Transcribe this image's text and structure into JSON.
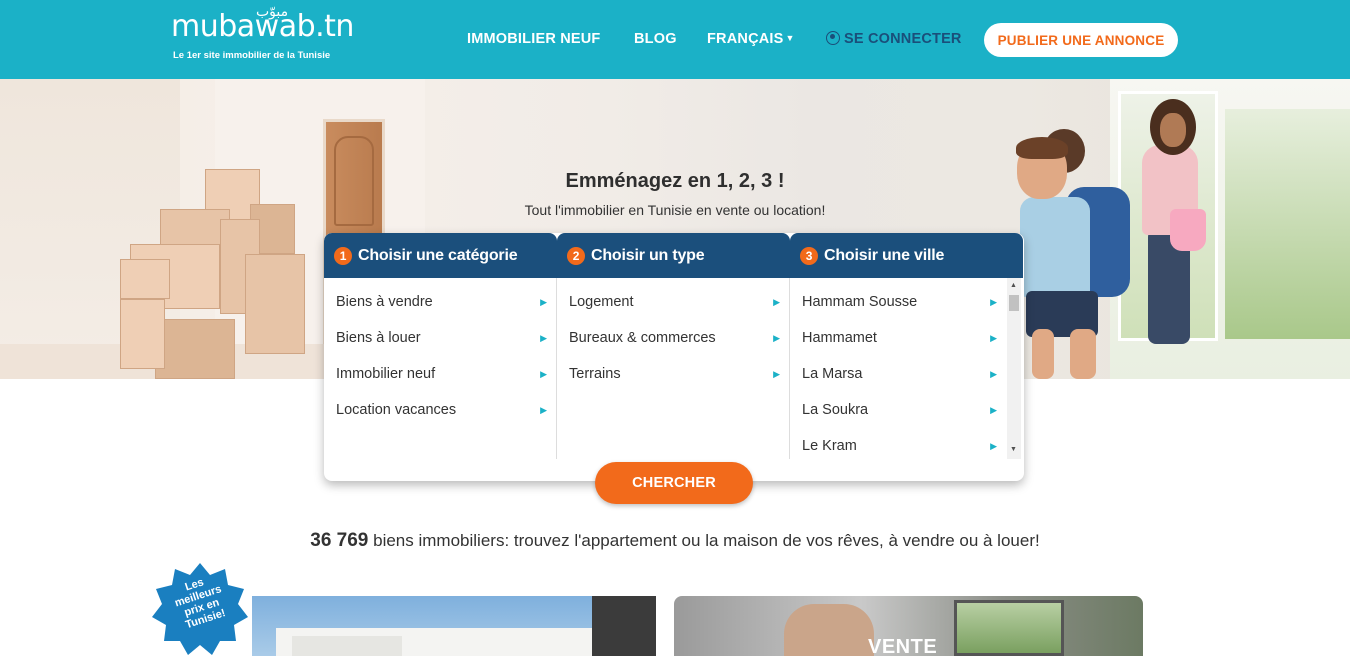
{
  "header": {
    "logo_text": "mubawab.tn",
    "logo_arabic": "مبوّب",
    "logo_tagline": "Le 1er site immobilier de la Tunisie",
    "nav": {
      "immobilier_neuf": "IMMOBILIER NEUF",
      "blog": "BLOG",
      "language": "FRANÇAIS",
      "login": "SE CONNECTER"
    },
    "publish_button": "PUBLIER UNE ANNONCE",
    "background_color": "#1bb1c7"
  },
  "hero": {
    "title": "Emménagez en 1, 2, 3 !",
    "subtitle": "Tout l'immobilier en Tunisie en vente ou location!"
  },
  "search": {
    "category": {
      "step": "1",
      "header": "Choisir une catégorie",
      "items": [
        "Biens à vendre",
        "Biens à louer",
        "Immobilier neuf",
        "Location vacances"
      ]
    },
    "type": {
      "step": "2",
      "header": "Choisir un type",
      "items": [
        "Logement",
        "Bureaux & commerces",
        "Terrains"
      ]
    },
    "city": {
      "step": "3",
      "header": "Choisir une ville",
      "items": [
        "Hammam Sousse",
        "Hammamet",
        "La Marsa",
        "La Soukra",
        "Le Kram"
      ]
    },
    "button": "CHERCHER",
    "header_color": "#1b4f7c",
    "accent_color": "#f26a1b"
  },
  "summary": {
    "count": "36 769",
    "text": "biens immobiliers: trouvez l'appartement ou la maison de vos rêves, à vendre ou à louer!"
  },
  "cards": {
    "badge_text": "Les meilleurs prix en Tunisie!",
    "sale_label": "VENTE"
  }
}
